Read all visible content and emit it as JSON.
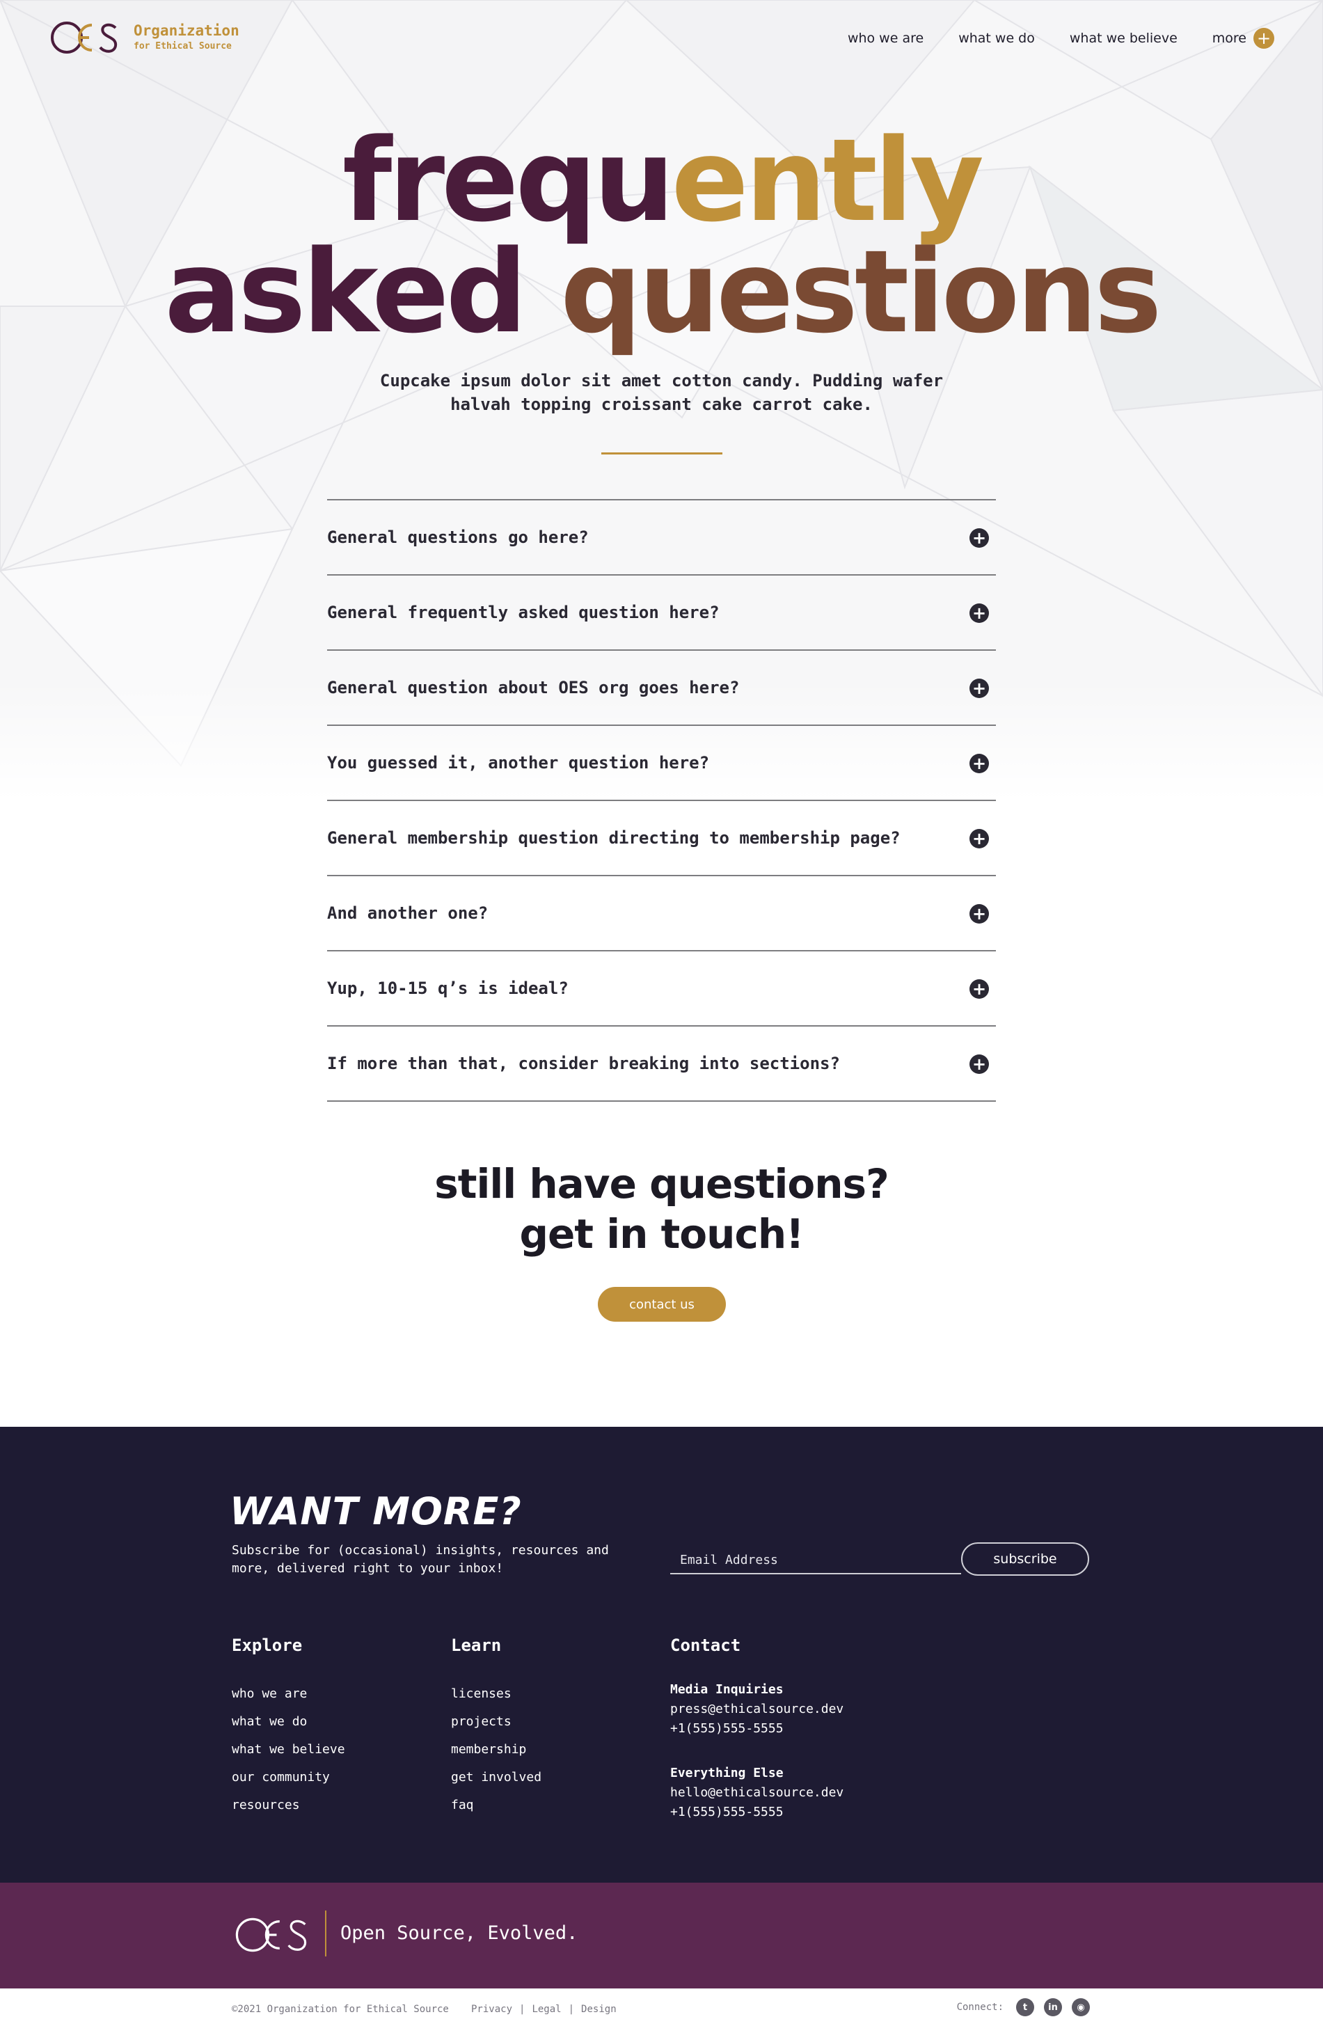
{
  "header": {
    "logo_line1": "Organization",
    "logo_line2": "for Ethical Source",
    "nav": [
      "who we are",
      "what we do",
      "what we believe",
      "more"
    ]
  },
  "hero": {
    "title_part1": "frequ",
    "title_part2": "ently",
    "title_part3": "asked ",
    "title_part4": "questions",
    "subtitle": "Cupcake ipsum dolor sit amet cotton candy. Pudding wafer halvah topping croissant cake carrot cake."
  },
  "faq": [
    "General questions go here?",
    "General frequently asked question here?",
    "General question about OES org goes here?",
    "You guessed it, another question here?",
    "General membership question directing to membership page?",
    "And another one?",
    "Yup, 10-15 q’s is ideal?",
    "If more than that, consider breaking into sections?"
  ],
  "cta": {
    "line1": "still have questions?",
    "line2": "get in touch!",
    "button": "contact us"
  },
  "footer": {
    "heading": "WANT MORE?",
    "subscribe_text": "Subscribe for (occasional) insights, resources and more, delivered right to your inbox!",
    "email_placeholder": "Email Address",
    "subscribe_button": "subscribe",
    "explore": {
      "heading": "Explore",
      "links": [
        "who we are",
        "what we do",
        "what we believe",
        "our community",
        "resources"
      ]
    },
    "learn": {
      "heading": "Learn",
      "links": [
        "licenses",
        "projects",
        "membership",
        "get involved",
        "faq"
      ]
    },
    "contact": {
      "heading": "Contact",
      "media_label": "Media Inquiries",
      "media_email": "press@ethicalsource.dev",
      "media_phone": "+1(555)555-5555",
      "else_label": "Everything Else",
      "else_email": "hello@ethicalsource.dev",
      "else_phone": "+1(555)555-5555"
    },
    "tagline": "Open Source, Evolved.",
    "copyright": "©2021 Organization for Ethical Source",
    "legal_links": [
      "Privacy",
      "Legal",
      "Design"
    ],
    "connect_label": "Connect:"
  },
  "colors": {
    "gold": "#c0913a",
    "plum": "#4a1c3b",
    "navy": "#1e1b33",
    "purple_bar": "#5c2851"
  },
  "icons": [
    "oes-logo",
    "plus-icon",
    "twitter-icon",
    "linkedin-icon",
    "github-icon"
  ]
}
